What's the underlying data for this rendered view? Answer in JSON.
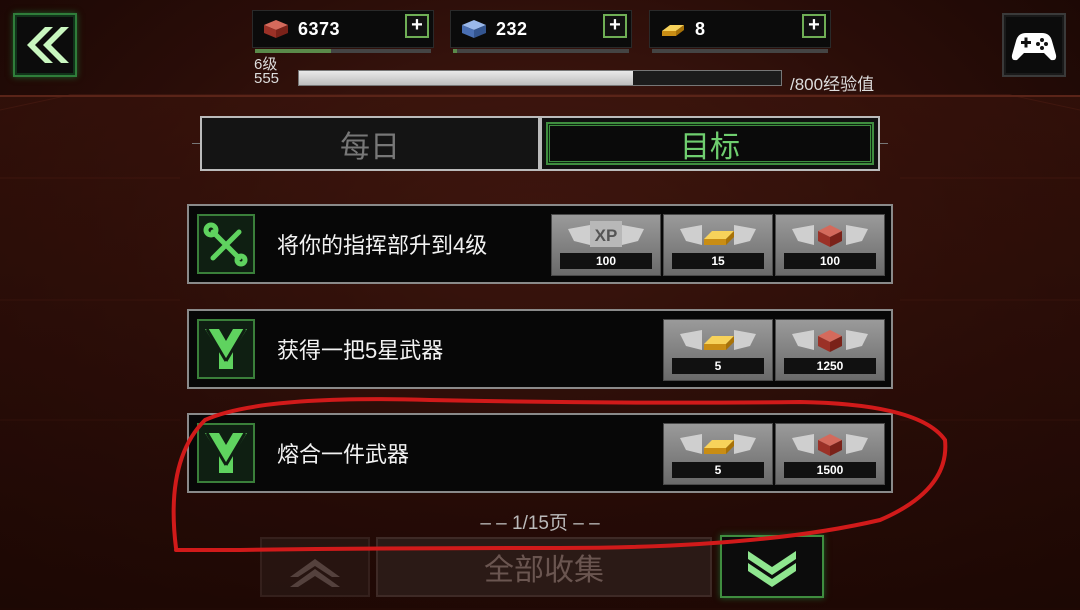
{
  "resources": [
    {
      "name": "iron-resource",
      "value": "6373",
      "icon": "iron-block-icon",
      "color": "#c0453a",
      "progress": 0.43
    },
    {
      "name": "crystal-resource",
      "value": "232",
      "icon": "crystal-block-icon",
      "color": "#5b84c9",
      "progress": 0.02
    },
    {
      "name": "gold-resource",
      "value": "8",
      "icon": "gold-bar-icon",
      "color": "#e8b02a",
      "progress": 0
    }
  ],
  "level": {
    "label": "6级",
    "xp_current": "555",
    "xp_max": "/800经验值",
    "xp_progress": 0.6937
  },
  "tabs": [
    {
      "label": "每日"
    },
    {
      "label": "目标",
      "active": true
    }
  ],
  "quests": [
    {
      "text": "将你的指挥部升到4级",
      "icon": "wrench-screwdriver-icon",
      "rewards": [
        {
          "icon": "xp-badge-icon",
          "label": "XP",
          "value": "100"
        },
        {
          "icon": "gold-bar-icon",
          "value": "15"
        },
        {
          "icon": "iron-block-icon",
          "value": "100"
        }
      ]
    },
    {
      "text": "获得一把5星武器",
      "icon": "weapon-emblem-icon",
      "rewards": [
        {
          "icon": "gold-bar-icon",
          "value": "5"
        },
        {
          "icon": "iron-block-icon",
          "value": "1250"
        }
      ]
    },
    {
      "text": "熔合一件武器",
      "icon": "weapon-emblem-icon",
      "rewards": [
        {
          "icon": "gold-bar-icon",
          "value": "5"
        },
        {
          "icon": "iron-block-icon",
          "value": "1500"
        }
      ]
    }
  ],
  "paging": "– – 1/15页 – –",
  "bottom": {
    "collect_all": "全部收集"
  },
  "accent_green": "#3f8d3f",
  "annotation_color": "#d11a1a"
}
